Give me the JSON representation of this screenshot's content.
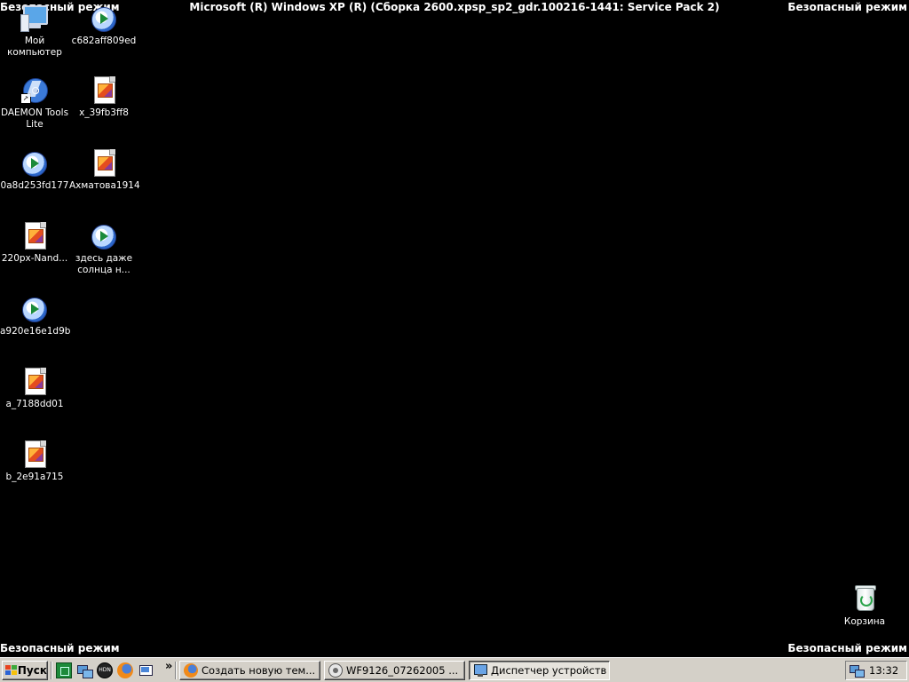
{
  "safe_mode_label": "Безопасный режим",
  "os_title": "Microsoft (R) Windows XP (R) (Сборка 2600.xpsp_sp2_gdr.100216-1441: Service Pack 2)",
  "desktop_icons": [
    {
      "label": "Мой компьютер",
      "icon": "my-computer-icon"
    },
    {
      "label": "c682aff809ed",
      "icon": "media-player-file-icon"
    },
    {
      "label": "DAEMON Tools Lite",
      "icon": "daemon-tools-shortcut-icon"
    },
    {
      "label": "x_39fb3ff8",
      "icon": "image-file-icon"
    },
    {
      "label": "0a8d253fd177",
      "icon": "media-player-file-icon"
    },
    {
      "label": "Ахматова1914",
      "icon": "image-file-icon"
    },
    {
      "label": "220px-Nand...",
      "icon": "image-file-icon"
    },
    {
      "label": "здесь даже солнца н...",
      "icon": "media-player-file-icon"
    },
    {
      "label": "a920e16e1d9b",
      "icon": "media-player-file-icon"
    },
    {
      "label": "a_7188dd01",
      "icon": "image-file-icon"
    },
    {
      "label": "b_2e91a715",
      "icon": "image-file-icon"
    },
    {
      "label": "Корзина",
      "icon": "recycle-bin-icon"
    }
  ],
  "taskbar": {
    "start_label": "Пуск",
    "quick_launch": [
      "green-app-icon",
      "network-icon",
      "hdn-icon",
      "firefox-icon",
      "show-desktop-icon"
    ],
    "overflow_glyph": "»",
    "tasks": [
      {
        "label": "Создать новую тем...",
        "icon": "firefox-icon",
        "active": false
      },
      {
        "label": "WF9126_07262005 ...",
        "icon": "image-viewer-icon",
        "active": false
      },
      {
        "label": "Диспетчер устройств",
        "icon": "device-manager-icon",
        "active": true
      }
    ],
    "clock": "13:32",
    "tray_icons": [
      "network-connection-icon"
    ]
  }
}
